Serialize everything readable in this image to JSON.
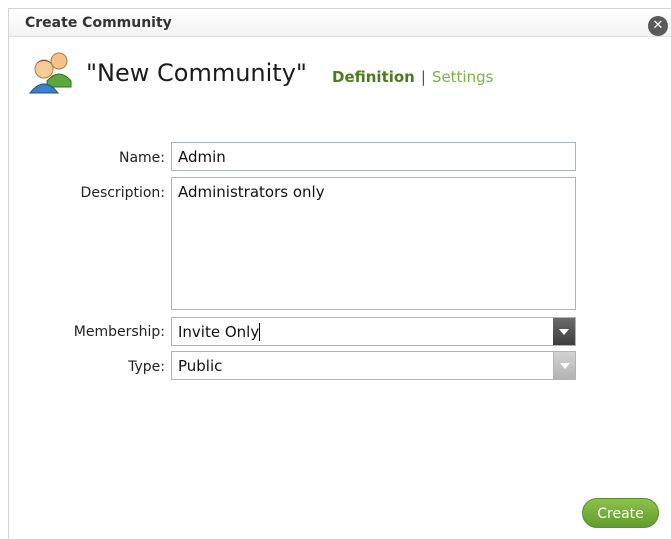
{
  "dialog": {
    "title": "Create Community",
    "close_icon": "close-icon",
    "community_icon": "users-icon"
  },
  "header": {
    "community_name": "\"New Community\"",
    "tabs": [
      {
        "label": "Definition",
        "active": true
      },
      {
        "label": "Settings",
        "active": false
      }
    ],
    "tab_separator": "|"
  },
  "form": {
    "name_label": "Name:",
    "name_value": "Admin",
    "description_label": "Description:",
    "description_value": "Administrators only",
    "membership_label": "Membership:",
    "membership_value": "Invite Only",
    "type_label": "Type:",
    "type_value": "Public"
  },
  "footer": {
    "create_label": "Create"
  },
  "colors": {
    "accent_green": "#7cb342",
    "active_tab": "#4b7d1f"
  }
}
